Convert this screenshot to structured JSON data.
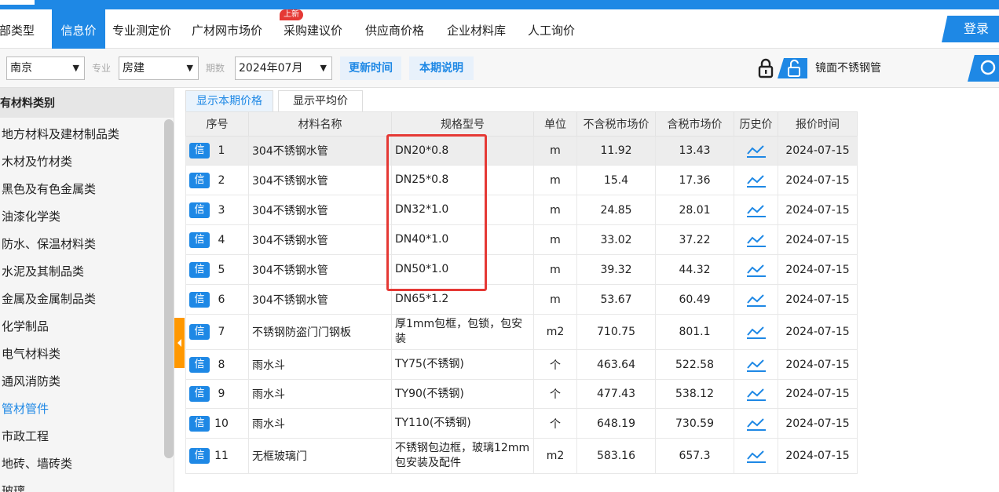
{
  "nav": {
    "items": [
      {
        "label": "全部类型",
        "active": false
      },
      {
        "label": "信息价",
        "active": true
      },
      {
        "label": "专业测定价",
        "active": false
      },
      {
        "label": "广材网市场价",
        "active": false
      },
      {
        "label": "采购建议价",
        "active": false
      },
      {
        "label": "供应商价格",
        "active": false
      },
      {
        "label": "企业材料库",
        "active": false
      },
      {
        "label": "人工询价",
        "active": false
      }
    ],
    "new_badge": "上新",
    "login_label": "登录"
  },
  "filters": {
    "city": "南京",
    "major_label": "专业",
    "major": "房建",
    "period_label": "期数",
    "period": "2024年07月",
    "update_time_btn": "更新时间",
    "period_note_btn": "本期说明",
    "search_value": "镜面不锈钢管"
  },
  "sidebar": {
    "header": "所有材料类别",
    "items": [
      {
        "label": "地方材料及建材制品类",
        "active": false
      },
      {
        "label": "木材及竹材类",
        "active": false
      },
      {
        "label": "黑色及有色金属类",
        "active": false
      },
      {
        "label": "油漆化学类",
        "active": false
      },
      {
        "label": "防水、保温材料类",
        "active": false
      },
      {
        "label": "水泥及其制品类",
        "active": false
      },
      {
        "label": "金属及金属制品类",
        "active": false
      },
      {
        "label": "化学制品",
        "active": false
      },
      {
        "label": "电气材料类",
        "active": false
      },
      {
        "label": "通风消防类",
        "active": false
      },
      {
        "label": "管材管件",
        "active": true
      },
      {
        "label": "市政工程",
        "active": false
      },
      {
        "label": "地砖、墙砖类",
        "active": false
      },
      {
        "label": "玻璃",
        "active": false
      }
    ]
  },
  "tabs": [
    {
      "label": "显示本期价格",
      "active": true
    },
    {
      "label": "显示平均价",
      "active": false
    }
  ],
  "table": {
    "badge": "信",
    "headers": [
      "序号",
      "材料名称",
      "规格型号",
      "单位",
      "不含税市场价",
      "含税市场价",
      "历史价",
      "报价时间"
    ],
    "rows": [
      {
        "idx": "1",
        "name": "304不锈钢水管",
        "spec": "DN20*0.8",
        "unit": "m",
        "price_ex": "11.92",
        "price_in": "13.43",
        "date": "2024-07-15"
      },
      {
        "idx": "2",
        "name": "304不锈钢水管",
        "spec": "DN25*0.8",
        "unit": "m",
        "price_ex": "15.4",
        "price_in": "17.36",
        "date": "2024-07-15"
      },
      {
        "idx": "3",
        "name": "304不锈钢水管",
        "spec": "DN32*1.0",
        "unit": "m",
        "price_ex": "24.85",
        "price_in": "28.01",
        "date": "2024-07-15"
      },
      {
        "idx": "4",
        "name": "304不锈钢水管",
        "spec": "DN40*1.0",
        "unit": "m",
        "price_ex": "33.02",
        "price_in": "37.22",
        "date": "2024-07-15"
      },
      {
        "idx": "5",
        "name": "304不锈钢水管",
        "spec": "DN50*1.0",
        "unit": "m",
        "price_ex": "39.32",
        "price_in": "44.32",
        "date": "2024-07-15"
      },
      {
        "idx": "6",
        "name": "304不锈钢水管",
        "spec": "DN65*1.2",
        "unit": "m",
        "price_ex": "53.67",
        "price_in": "60.49",
        "date": "2024-07-15"
      },
      {
        "idx": "7",
        "name": "不锈钢防盗门门钢板",
        "spec": "厚1mm包框，包锁，包安装",
        "unit": "m2",
        "price_ex": "710.75",
        "price_in": "801.1",
        "date": "2024-07-15"
      },
      {
        "idx": "8",
        "name": "雨水斗",
        "spec": "TY75(不锈钢)",
        "unit": "个",
        "price_ex": "463.64",
        "price_in": "522.58",
        "date": "2024-07-15"
      },
      {
        "idx": "9",
        "name": "雨水斗",
        "spec": "TY90(不锈钢)",
        "unit": "个",
        "price_ex": "477.43",
        "price_in": "538.12",
        "date": "2024-07-15"
      },
      {
        "idx": "10",
        "name": "雨水斗",
        "spec": "TY110(不锈钢)",
        "unit": "个",
        "price_ex": "648.19",
        "price_in": "730.59",
        "date": "2024-07-15"
      },
      {
        "idx": "11",
        "name": "无框玻璃门",
        "spec": "不锈钢包边框，玻璃12mm包安装及配件",
        "unit": "m2",
        "price_ex": "583.16",
        "price_in": "657.3",
        "date": "2024-07-15"
      }
    ]
  },
  "colors": {
    "accent": "#1e88e5",
    "highlight": "#e53935",
    "handle": "#ff9800"
  }
}
